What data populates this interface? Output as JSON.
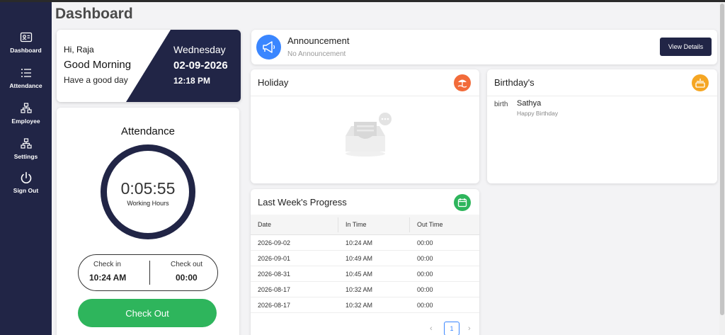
{
  "sidebar": {
    "items": [
      {
        "label": "Dashboard"
      },
      {
        "label": "Attendance"
      },
      {
        "label": "Employee"
      },
      {
        "label": "Settings"
      },
      {
        "label": "Sign Out"
      }
    ]
  },
  "page": {
    "title": "Dashboard"
  },
  "greeting": {
    "hi": "Hi, Raja",
    "good_morning": "Good Morning",
    "have_good_day": "Have a good day",
    "weekday": "Wednesday",
    "date": "02-09-2026",
    "time": "12:18 PM"
  },
  "attendance": {
    "title": "Attendance",
    "timer": "0:05:55",
    "timer_label": "Working Hours",
    "check_in_label": "Check in",
    "check_in_value": "10:24 AM",
    "check_out_label": "Check out",
    "check_out_value": "00:00",
    "checkout_button": "Check Out"
  },
  "announcement": {
    "title": "Announcement",
    "subtitle": "No Announcement",
    "button": "View Details"
  },
  "holiday": {
    "title": "Holiday"
  },
  "birthday": {
    "title": "Birthday's",
    "image_alt": "birth",
    "name": "Sathya",
    "message": "Happy Birthday"
  },
  "progress": {
    "title": "Last Week's Progress",
    "columns": [
      "Date",
      "In Time",
      "Out Time"
    ],
    "rows": [
      [
        "2026-09-02",
        "10:24 AM",
        "00:00"
      ],
      [
        "2026-09-01",
        "10:49 AM",
        "00:00"
      ],
      [
        "2026-08-31",
        "10:45 AM",
        "00:00"
      ],
      [
        "2026-08-17",
        "10:32 AM",
        "00:00"
      ],
      [
        "2026-08-17",
        "10:32 AM",
        "00:00"
      ]
    ],
    "page": "1"
  },
  "colors": {
    "sidebar": "#212546",
    "accent_blue": "#3a86ff",
    "check_out_green": "#2eb55c",
    "holiday_badge": "#f26b3a",
    "birthday_badge": "#f5a623",
    "progress_badge": "#2eb55c"
  }
}
